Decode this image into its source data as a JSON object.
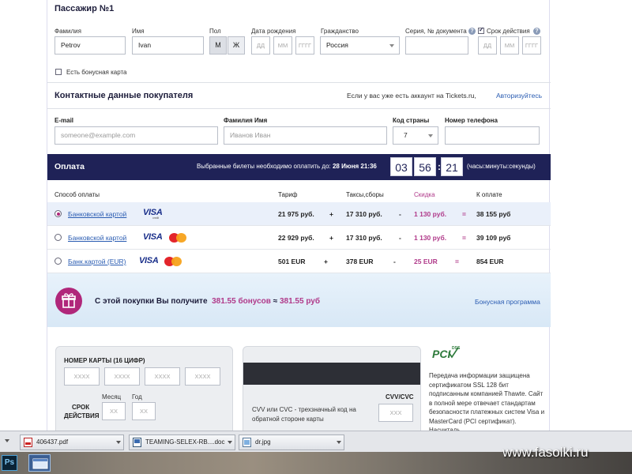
{
  "passenger": {
    "title": "Пассажир №1",
    "labels": {
      "surname": "Фамилия",
      "name": "Имя",
      "sex": "Пол",
      "birthdate": "Дата рождения",
      "citizenship": "Гражданство",
      "document": "Серия, № документа",
      "validity": "Срок действия"
    },
    "surname_value": "Petrov",
    "name_value": "Ivan",
    "sex_options": [
      "М",
      "Ж"
    ],
    "date_placeholders": {
      "day": "ДД",
      "month": "ММ",
      "year": "ГГГГ"
    },
    "citizenship_value": "Россия",
    "validity_checked": true,
    "help_glyph": "?",
    "bonus_card_label": "Есть бонусная карта"
  },
  "contacts": {
    "title": "Контактные данные покупателя",
    "account_text": "Если у вас уже есть аккаунт на Tickets.ru,",
    "login_link": "Авторизуйтесь",
    "labels": {
      "email": "E-mail",
      "fullname": "Фамилия Имя",
      "country_code": "Код страны",
      "phone": "Номер телефона"
    },
    "email_placeholder": "someone@example.com",
    "fullname_placeholder": "Иванов Иван",
    "country_code_value": "7"
  },
  "payment": {
    "title": "Оплата",
    "deadline_text": "Выбранные билеты необходимо оплатить до:",
    "deadline_value": "28 Июня 21:36",
    "timer": {
      "hours": "03",
      "minutes": "56",
      "seconds": "21",
      "sep": ":"
    },
    "timer_units": "(часы:минуты:секунды)",
    "headers": {
      "method": "Способ оплаты",
      "fare": "Тариф",
      "taxes": "Таксы,сборы",
      "discount": "Скидка",
      "total": "К оплате"
    },
    "rows": [
      {
        "method": "Банковской картой",
        "fare": "21 975 руб.",
        "plus": "+",
        "taxes": "17 310 руб.",
        "minus": "-",
        "discount": "1 130 руб.",
        "eq": "=",
        "total": "38 155 руб",
        "selected": true
      },
      {
        "method": "Банковской картой",
        "fare": "22 929 руб.",
        "plus": "+",
        "taxes": "17 310 руб.",
        "minus": "-",
        "discount": "1 130 руб.",
        "eq": "=",
        "total": "39 109 руб",
        "selected": false
      },
      {
        "method": "Банк.картой (EUR)",
        "fare": "501 EUR",
        "plus": "+",
        "taxes": "378 EUR",
        "minus": "-",
        "discount": "25 EUR",
        "eq": "=",
        "total": "854 EUR",
        "selected": false
      }
    ],
    "visa_label": "VISA",
    "visa_sub": "credit"
  },
  "bonus": {
    "text_before": "С этой покупки Вы получите",
    "amount_bonuses": "381.55 бонусов",
    "approx": "≈",
    "amount_rub": "381.55 руб",
    "program_link": "Бонусная программа"
  },
  "card": {
    "number_label": "НОМЕР КАРТЫ (16 ЦИФР)",
    "number_placeholders": [
      "XXXX",
      "XXXX",
      "XXXX",
      "XXXX"
    ],
    "expiry_label_1": "СРОК",
    "expiry_label_2": "ДЕЙСТВИЯ",
    "month_label": "Месяц",
    "year_label": "Год",
    "month_placeholder": "XX",
    "year_placeholder": "XX",
    "cvv_note": "CVV или CVC - трехзначный код на обратной стороне карты",
    "cvv_label": "CVV/CVC",
    "cvv_placeholder": "XXX"
  },
  "security": {
    "pci_text": "PCI",
    "pci_dss": "DSS",
    "note": "Передача информации защищена сертификатом SSL 128 бит подписанным компанией Thawte. Сайт в полной мере отвечает стандартам безопасности платежных систем Visa и MasterCard (PCI сертификат). Насчиталь"
  },
  "taskbar": {
    "items": [
      {
        "label": "406437.pdf"
      },
      {
        "label": "TEAMING-SELEX-RB....doc"
      },
      {
        "label": "dr.jpg"
      }
    ]
  },
  "dock": {
    "ps_label": "Ps"
  },
  "watermark": "www.fasolki.ru"
}
